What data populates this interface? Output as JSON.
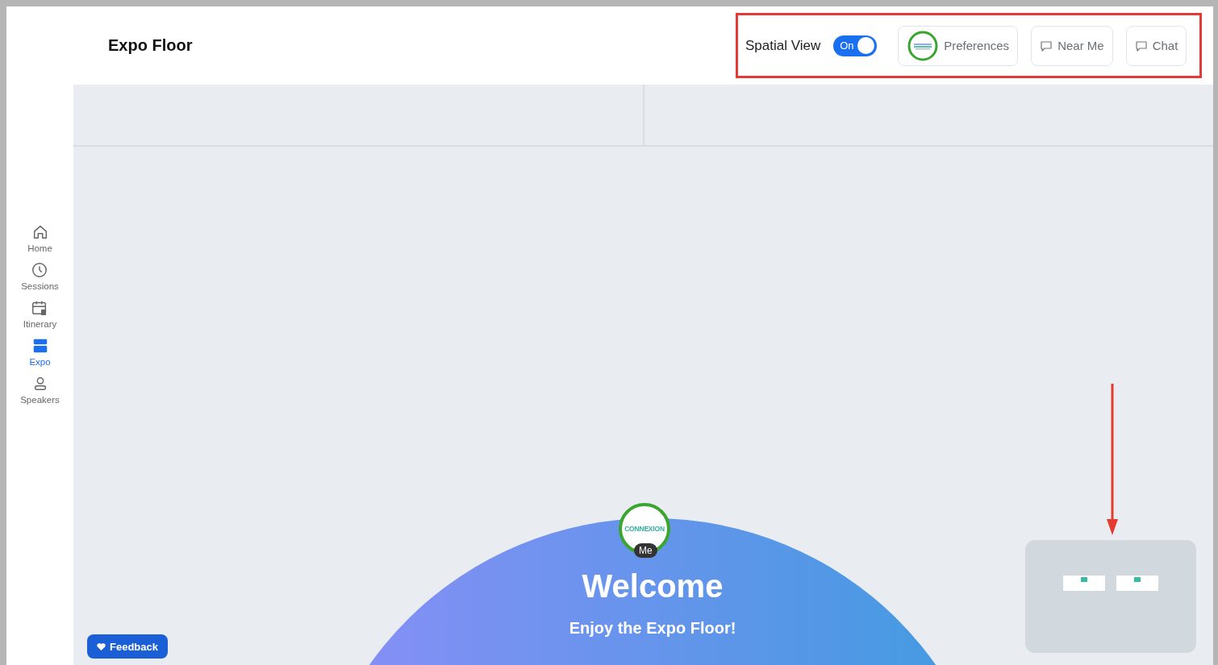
{
  "header": {
    "title": "Expo Floor",
    "spatial_view": {
      "label": "Spatial View",
      "on": true,
      "state_label": "On"
    },
    "buttons": [
      {
        "kind": "avatar",
        "label": "Preferences"
      },
      {
        "kind": "chat",
        "label": "Near Me"
      },
      {
        "kind": "chat",
        "label": "Chat"
      }
    ]
  },
  "sidebar": {
    "items": [
      {
        "kind": "home",
        "label": "Home",
        "selected": false
      },
      {
        "kind": "clock",
        "label": "Sessions",
        "selected": false
      },
      {
        "kind": "calendar",
        "label": "Itinerary",
        "selected": false
      },
      {
        "kind": "booth",
        "label": "Expo",
        "selected": true
      },
      {
        "kind": "person",
        "label": "Speakers",
        "selected": false
      }
    ]
  },
  "floor": {
    "welcome": {
      "title": "Welcome",
      "subtitle": "Enjoy the Expo Floor!",
      "avatar_logo": "CONNEXION",
      "avatar_badge": "Me"
    },
    "minimap": {
      "booths": [
        {
          "kind": "booth"
        },
        {
          "kind": "booth"
        }
      ]
    },
    "feedback": {
      "label": "Feedback"
    }
  }
}
